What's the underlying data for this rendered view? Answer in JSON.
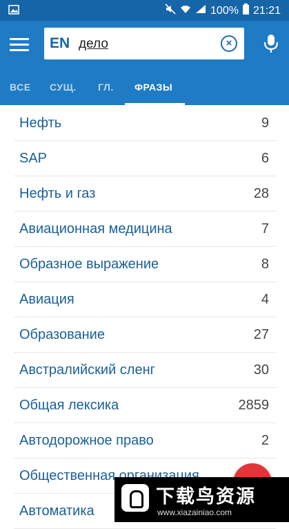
{
  "status_bar": {
    "battery_text": "100%",
    "time": "21:21",
    "icons": [
      "gallery-icon",
      "mute-icon",
      "wifi-icon",
      "signal-icon",
      "battery-icon"
    ]
  },
  "search": {
    "language": "EN",
    "query": "дело"
  },
  "tabs": [
    {
      "label": "ВСЕ"
    },
    {
      "label": "СУЩ."
    },
    {
      "label": "ГЛ."
    },
    {
      "label": "ФРАЗЫ",
      "active": true
    }
  ],
  "results": [
    {
      "label": "Нефть",
      "count": "9"
    },
    {
      "label": "SAP",
      "count": "6"
    },
    {
      "label": "Нефть и газ",
      "count": "28"
    },
    {
      "label": "Авиационная медицина",
      "count": "7"
    },
    {
      "label": "Образное выражение",
      "count": "8"
    },
    {
      "label": "Авиация",
      "count": "4"
    },
    {
      "label": "Образование",
      "count": "27"
    },
    {
      "label": "Австралийский сленг",
      "count": "30"
    },
    {
      "label": "Общая лексика",
      "count": "2859"
    },
    {
      "label": "Автодорожное право",
      "count": "2"
    },
    {
      "label": "Общественная организация",
      "count": ""
    },
    {
      "label": "Автоматика",
      "count": ""
    }
  ],
  "watermark": {
    "title": "下载鸟资源",
    "url": "www.xiazainiao.com"
  },
  "colors": {
    "status_bar": "#1565a8",
    "app_bar": "#1e7bc4",
    "link_text": "#1a5f97",
    "fab": "#e2353a"
  }
}
